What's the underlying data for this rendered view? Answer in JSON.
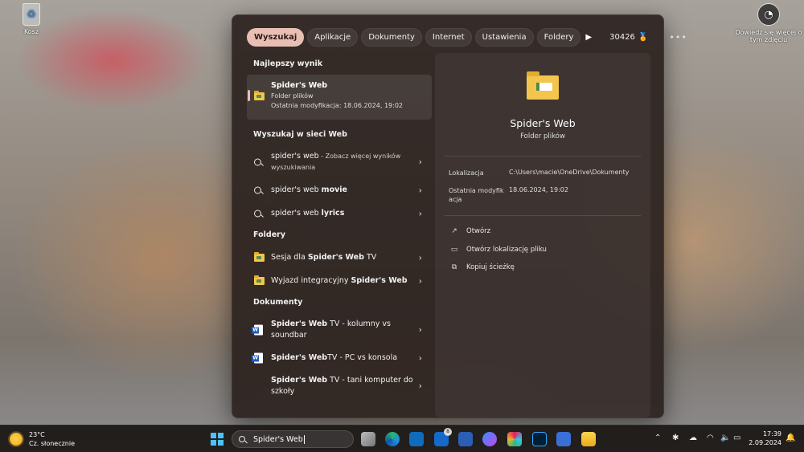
{
  "desktop": {
    "recycle_bin": "Kosz",
    "learn_more": "Dowiedz się więcej o tym zdjęciu"
  },
  "tabs": [
    {
      "label": "Wyszukaj",
      "active": true
    },
    {
      "label": "Aplikacje",
      "active": false
    },
    {
      "label": "Dokumenty",
      "active": false
    },
    {
      "label": "Internet",
      "active": false
    },
    {
      "label": "Ustawienia",
      "active": false
    },
    {
      "label": "Foldery",
      "active": false
    }
  ],
  "tabs_extra": {
    "play_icon": "play-icon",
    "points": "30426",
    "medal_icon": "medal-icon",
    "more_icon": "more-icon"
  },
  "best": {
    "heading": "Najlepszy wynik",
    "title": "Spider's Web",
    "type": "Folder plików",
    "modified": "Ostatnia modyfikacja: 18.06.2024, 19:02"
  },
  "web": {
    "heading": "Wyszukaj w sieci Web",
    "items": [
      {
        "query": "spider's web",
        "bold": "",
        "suffix": " - Zobacz więcej wyników wyszukiwania"
      },
      {
        "query": "spider's web ",
        "bold": "movie",
        "suffix": ""
      },
      {
        "query": "spider's web ",
        "bold": "lyrics",
        "suffix": ""
      }
    ]
  },
  "folders": {
    "heading": "Foldery",
    "items": [
      {
        "pre": "Sesja dla ",
        "bold": "Spider's Web",
        "post": " TV"
      },
      {
        "pre": "Wyjazd integracyjny ",
        "bold": "Spider's Web",
        "post": ""
      }
    ]
  },
  "documents": {
    "heading": "Dokumenty",
    "items": [
      {
        "bold": "Spider's Web",
        "post": " TV - kolumny vs soundbar"
      },
      {
        "bold": "Spider's Web",
        "post": " TV - PC vs konsola"
      },
      {
        "bold": "Spider's Web",
        "post": " TV - tani komputer do szkoły"
      }
    ]
  },
  "preview": {
    "title": "Spider's Web",
    "type": "Folder plików",
    "location_label": "Lokalizacja",
    "location_value": "C:\\Users\\macie\\OneDrive\\Dokumenty",
    "modified_label": "Ostatnia modyfik acja",
    "modified_value": "18.06.2024, 19:02",
    "actions": [
      {
        "label": "Otwórz",
        "icon": "open-external-icon"
      },
      {
        "label": "Otwórz lokalizację pliku",
        "icon": "folder-outline-icon"
      },
      {
        "label": "Kopiuj ścieżkę",
        "icon": "copy-icon"
      }
    ]
  },
  "taskbar": {
    "weather_temp": "23°C",
    "weather_desc": "Cz. słonecznie",
    "search_value": "Spider's Web",
    "badge_count": "8",
    "time": "17:39",
    "date": "2.09.2024"
  }
}
